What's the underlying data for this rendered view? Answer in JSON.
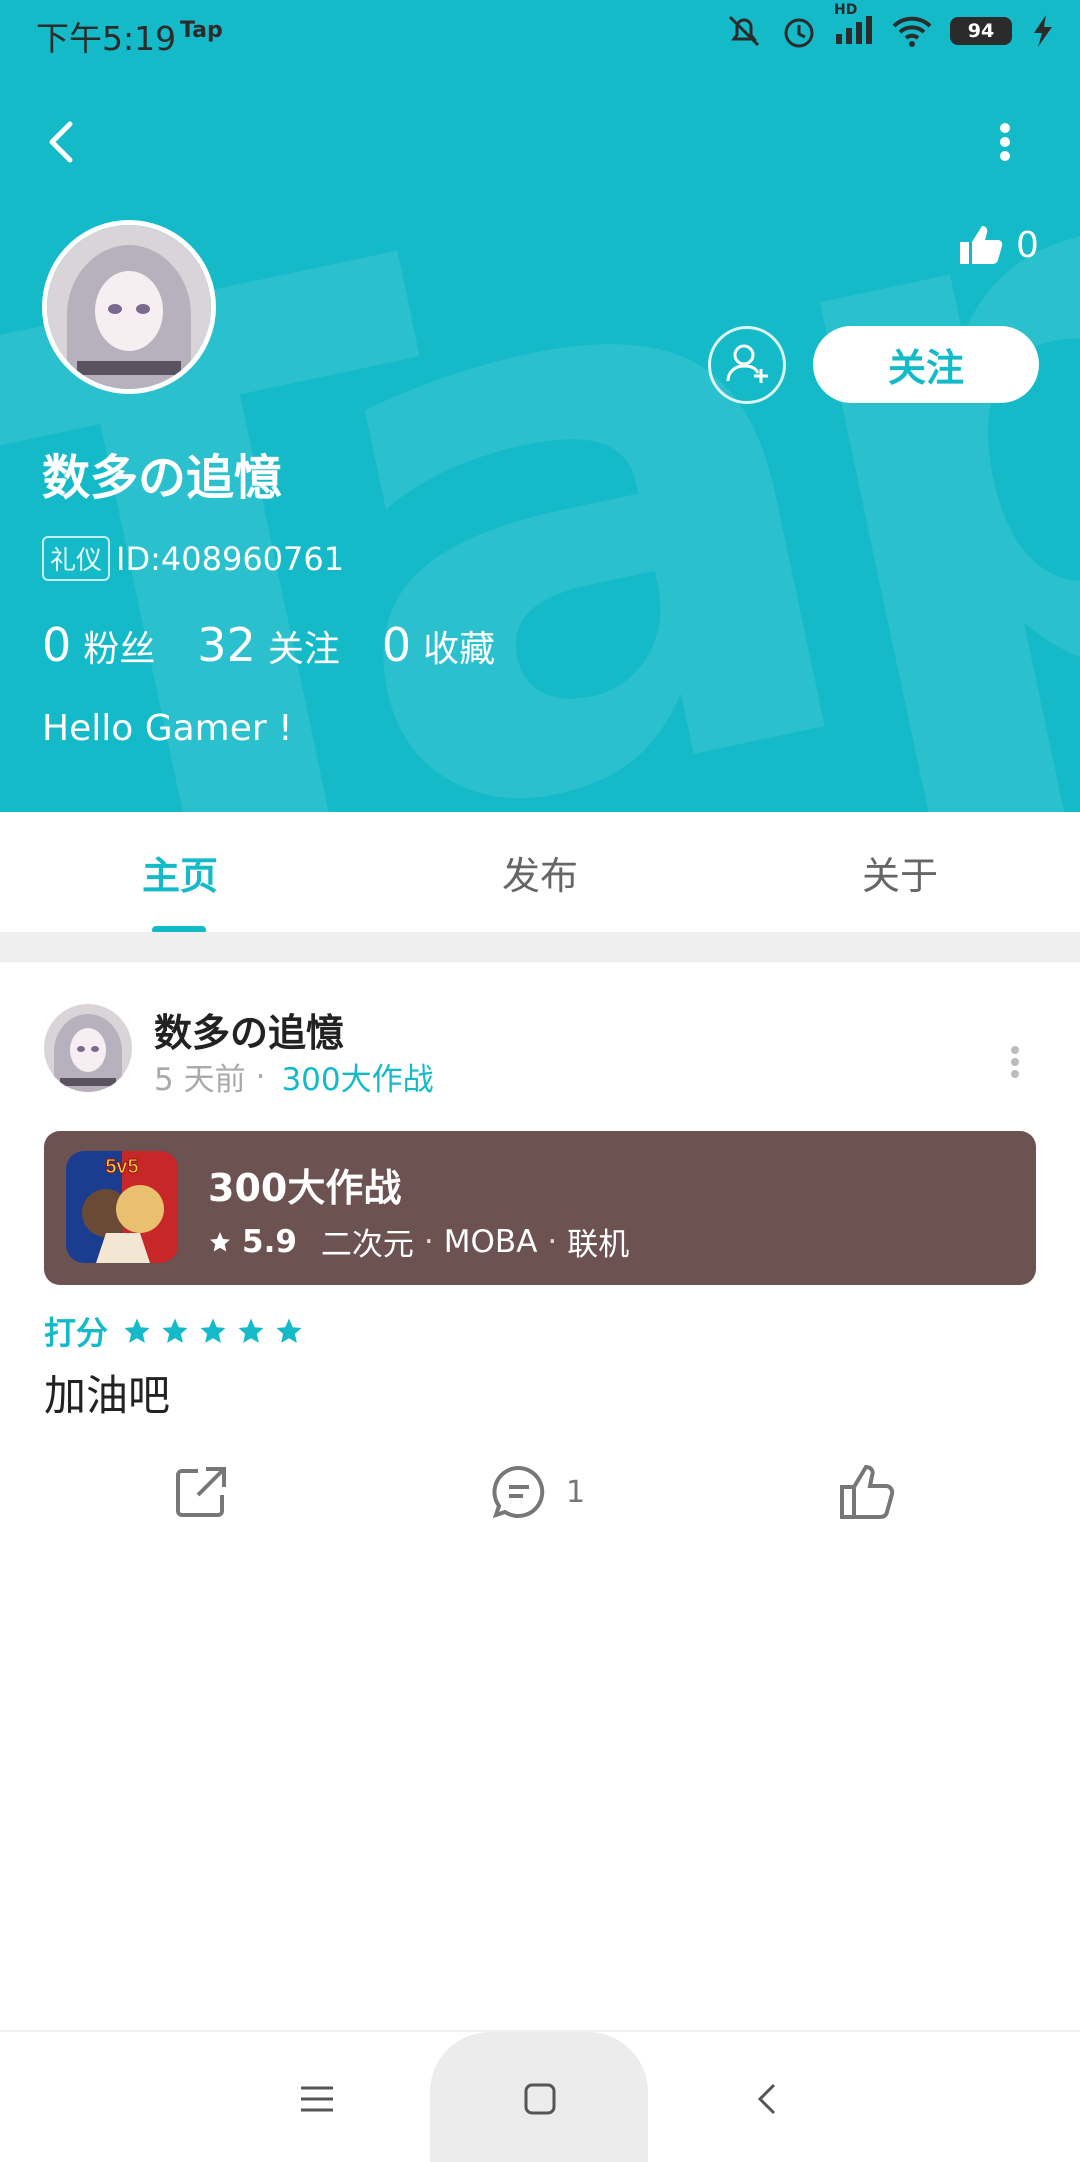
{
  "status_bar": {
    "time": "下午5:19",
    "app_label": "Tap",
    "battery": "94",
    "network_label": "HD"
  },
  "header": {
    "watermark": "Tap",
    "likes_count": "0",
    "follow_label": "关注",
    "username": "数多の追憶",
    "badge": "礼仪",
    "user_id": "ID:408960761",
    "stats": [
      {
        "number": "0",
        "label": "粉丝"
      },
      {
        "number": "32",
        "label": "关注"
      },
      {
        "number": "0",
        "label": "收藏"
      }
    ],
    "bio": "Hello Gamer !"
  },
  "tabs": [
    {
      "label": "主页",
      "active": true
    },
    {
      "label": "发布",
      "active": false
    },
    {
      "label": "关于",
      "active": false
    }
  ],
  "post": {
    "author": "数多の追憶",
    "time_ago": "5 天前",
    "separator": "·",
    "game_link": "300大作战",
    "game_card": {
      "title": "300大作战",
      "rating": "5.9",
      "tags": [
        "二次元",
        "MOBA",
        "联机"
      ],
      "icon_label": "5v5",
      "background": "#6d5252"
    },
    "score_label": "打分",
    "stars": 5,
    "content": "加油吧",
    "comment_count": "1"
  },
  "colors": {
    "accent": "#15bac9",
    "header_bg": "#15bac9"
  }
}
